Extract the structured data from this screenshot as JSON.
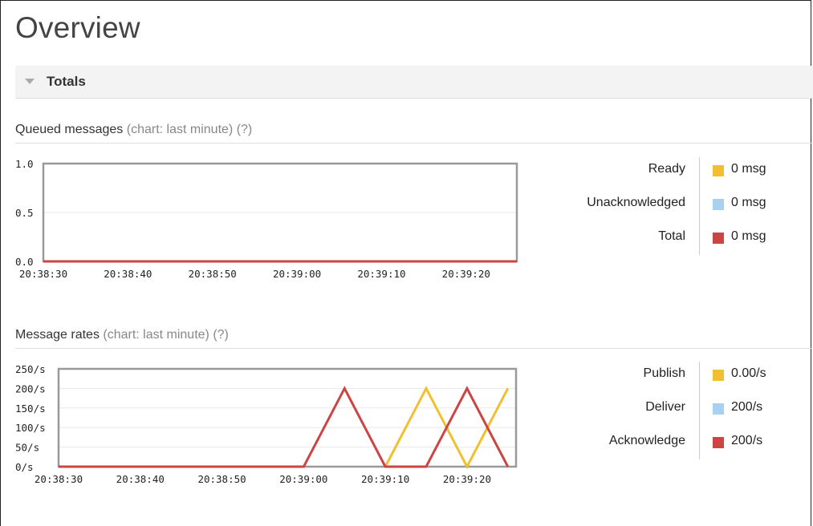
{
  "page": {
    "title": "Overview"
  },
  "totals_section": {
    "label": "Totals"
  },
  "queued": {
    "heading": "Queued messages",
    "chart_note": "(chart: last minute)",
    "help": "(?)",
    "legend": [
      {
        "label": "Ready",
        "value": "0 msg",
        "color": "#f0c030"
      },
      {
        "label": "Unacknowledged",
        "value": "0 msg",
        "color": "#a8d0f0"
      },
      {
        "label": "Total",
        "value": "0 msg",
        "color": "#cc4444"
      }
    ]
  },
  "rates": {
    "heading": "Message rates",
    "chart_note": "(chart: last minute)",
    "help": "(?)",
    "legend": [
      {
        "label": "Publish",
        "value": "0.00/s",
        "color": "#f0c030"
      },
      {
        "label": "Deliver",
        "value": "200/s",
        "color": "#a8d0f0"
      },
      {
        "label": "Acknowledge",
        "value": "200/s",
        "color": "#cc4444"
      }
    ]
  },
  "chart_data": [
    {
      "type": "line",
      "y_ticks": [
        "1.0",
        "0.5",
        "0.0"
      ],
      "ylim": [
        0,
        1
      ],
      "x_ticks": [
        "20:38:30",
        "20:38:40",
        "20:38:50",
        "20:39:00",
        "20:39:10",
        "20:39:20"
      ],
      "x_range": [
        "20:38:30",
        "20:39:26"
      ],
      "grid": true,
      "series": [
        {
          "name": "Ready",
          "color": "#f0c030",
          "x": [
            "20:38:30",
            "20:39:26"
          ],
          "y": [
            0,
            0
          ]
        },
        {
          "name": "Unacknowledged",
          "color": "#a8d0f0",
          "x": [
            "20:38:30",
            "20:39:26"
          ],
          "y": [
            0,
            0
          ]
        },
        {
          "name": "Total",
          "color": "#cc4444",
          "x": [
            "20:38:30",
            "20:39:26"
          ],
          "y": [
            0,
            0
          ]
        }
      ]
    },
    {
      "type": "line",
      "y_ticks": [
        "250/s",
        "200/s",
        "150/s",
        "100/s",
        "50/s",
        "0/s"
      ],
      "ylim": [
        0,
        250
      ],
      "x_ticks": [
        "20:38:30",
        "20:38:40",
        "20:38:50",
        "20:39:00",
        "20:39:10",
        "20:39:20"
      ],
      "x_range": [
        "20:38:30",
        "20:39:26"
      ],
      "grid": true,
      "series": [
        {
          "name": "Publish",
          "color": "#f0c030",
          "x": [
            "20:39:10",
            "20:39:15",
            "20:39:20",
            "20:39:25"
          ],
          "y": [
            0,
            200,
            0,
            200
          ]
        },
        {
          "name": "Acknowledge",
          "color": "#cc4444",
          "x": [
            "20:38:30",
            "20:39:00",
            "20:39:05",
            "20:39:10",
            "20:39:15",
            "20:39:20",
            "20:39:25"
          ],
          "y": [
            0,
            0,
            200,
            0,
            0,
            200,
            0
          ]
        }
      ]
    }
  ]
}
